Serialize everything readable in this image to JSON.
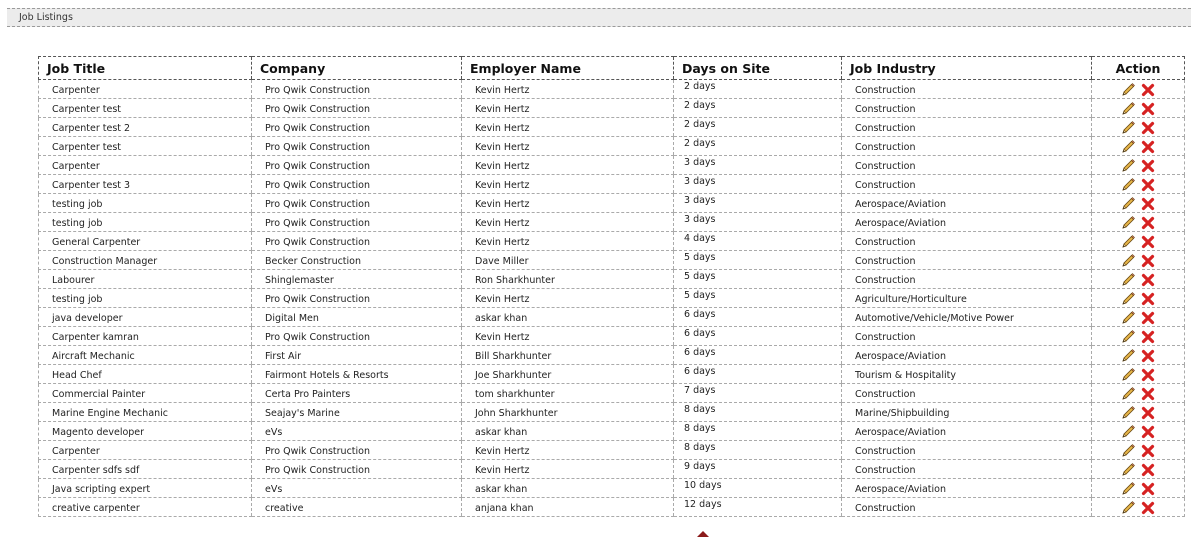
{
  "section": {
    "title": "Job Listings"
  },
  "table": {
    "headers": {
      "job_title": "Job Title",
      "company": "Company",
      "employer_name": "Employer Name",
      "days_on_site": "Days on Site",
      "job_industry": "Job Industry",
      "action": "Action"
    },
    "rows": [
      {
        "job_title": "Carpenter",
        "company": "Pro Qwik Construction",
        "employer": "Kevin Hertz",
        "days": "2 days",
        "industry": "Construction"
      },
      {
        "job_title": "Carpenter test",
        "company": "Pro Qwik Construction",
        "employer": "Kevin Hertz",
        "days": "2 days",
        "industry": "Construction"
      },
      {
        "job_title": "Carpenter test 2",
        "company": "Pro Qwik Construction",
        "employer": "Kevin Hertz",
        "days": "2 days",
        "industry": "Construction"
      },
      {
        "job_title": "Carpenter test",
        "company": "Pro Qwik Construction",
        "employer": "Kevin Hertz",
        "days": "2 days",
        "industry": "Construction"
      },
      {
        "job_title": "Carpenter",
        "company": "Pro Qwik Construction",
        "employer": "Kevin Hertz",
        "days": "3 days",
        "industry": "Construction"
      },
      {
        "job_title": "Carpenter test 3",
        "company": "Pro Qwik Construction",
        "employer": "Kevin Hertz",
        "days": "3 days",
        "industry": "Construction"
      },
      {
        "job_title": "testing job",
        "company": "Pro Qwik Construction",
        "employer": "Kevin Hertz",
        "days": "3 days",
        "industry": "Aerospace/Aviation"
      },
      {
        "job_title": "testing job",
        "company": "Pro Qwik Construction",
        "employer": "Kevin Hertz",
        "days": "3 days",
        "industry": "Aerospace/Aviation"
      },
      {
        "job_title": "General Carpenter",
        "company": "Pro Qwik Construction",
        "employer": "Kevin Hertz",
        "days": "4 days",
        "industry": "Construction"
      },
      {
        "job_title": "Construction Manager",
        "company": "Becker Construction",
        "employer": "Dave Miller",
        "days": "5 days",
        "industry": "Construction"
      },
      {
        "job_title": "Labourer",
        "company": "Shinglemaster",
        "employer": "Ron Sharkhunter",
        "days": "5 days",
        "industry": "Construction"
      },
      {
        "job_title": "testing job",
        "company": "Pro Qwik Construction",
        "employer": "Kevin Hertz",
        "days": "5 days",
        "industry": "Agriculture/Horticulture"
      },
      {
        "job_title": "java developer",
        "company": "Digital Men",
        "employer": "askar khan",
        "days": "6 days",
        "industry": "Automotive/Vehicle/Motive Power"
      },
      {
        "job_title": "Carpenter kamran",
        "company": "Pro Qwik Construction",
        "employer": "Kevin Hertz",
        "days": "6 days",
        "industry": "Construction"
      },
      {
        "job_title": "Aircraft Mechanic",
        "company": "First Air",
        "employer": "Bill Sharkhunter",
        "days": "6 days",
        "industry": "Aerospace/Aviation"
      },
      {
        "job_title": "Head Chef",
        "company": "Fairmont Hotels & Resorts",
        "employer": "Joe Sharkhunter",
        "days": "6 days",
        "industry": "Tourism & Hospitality"
      },
      {
        "job_title": "Commercial Painter",
        "company": "Certa Pro Painters",
        "employer": "tom sharkhunter",
        "days": "7 days",
        "industry": "Construction"
      },
      {
        "job_title": "Marine Engine Mechanic",
        "company": "Seajay's Marine",
        "employer": "John Sharkhunter",
        "days": "8 days",
        "industry": "Marine/Shipbuilding"
      },
      {
        "job_title": "Magento developer",
        "company": "eVs",
        "employer": "askar khan",
        "days": "8 days",
        "industry": "Aerospace/Aviation"
      },
      {
        "job_title": "Carpenter",
        "company": "Pro Qwik Construction",
        "employer": "Kevin Hertz",
        "days": "8 days",
        "industry": "Construction"
      },
      {
        "job_title": "Carpenter sdfs sdf",
        "company": "Pro Qwik Construction",
        "employer": "Kevin Hertz",
        "days": "9 days",
        "industry": "Construction"
      },
      {
        "job_title": "Java scripting expert",
        "company": "eVs",
        "employer": "askar khan",
        "days": "10 days",
        "industry": "Aerospace/Aviation"
      },
      {
        "job_title": "creative carpenter",
        "company": "creative",
        "employer": "anjana khan",
        "days": "12 days",
        "industry": "Construction"
      }
    ]
  },
  "icons": {
    "edit": "pencil-icon",
    "delete": "delete-x-icon",
    "scroll": "caret-up-icon"
  },
  "colors": {
    "header_bar": "#ececec",
    "delete_red": "#d62222",
    "pencil_body": "#e8b74a",
    "caret": "#8b1a1a"
  }
}
